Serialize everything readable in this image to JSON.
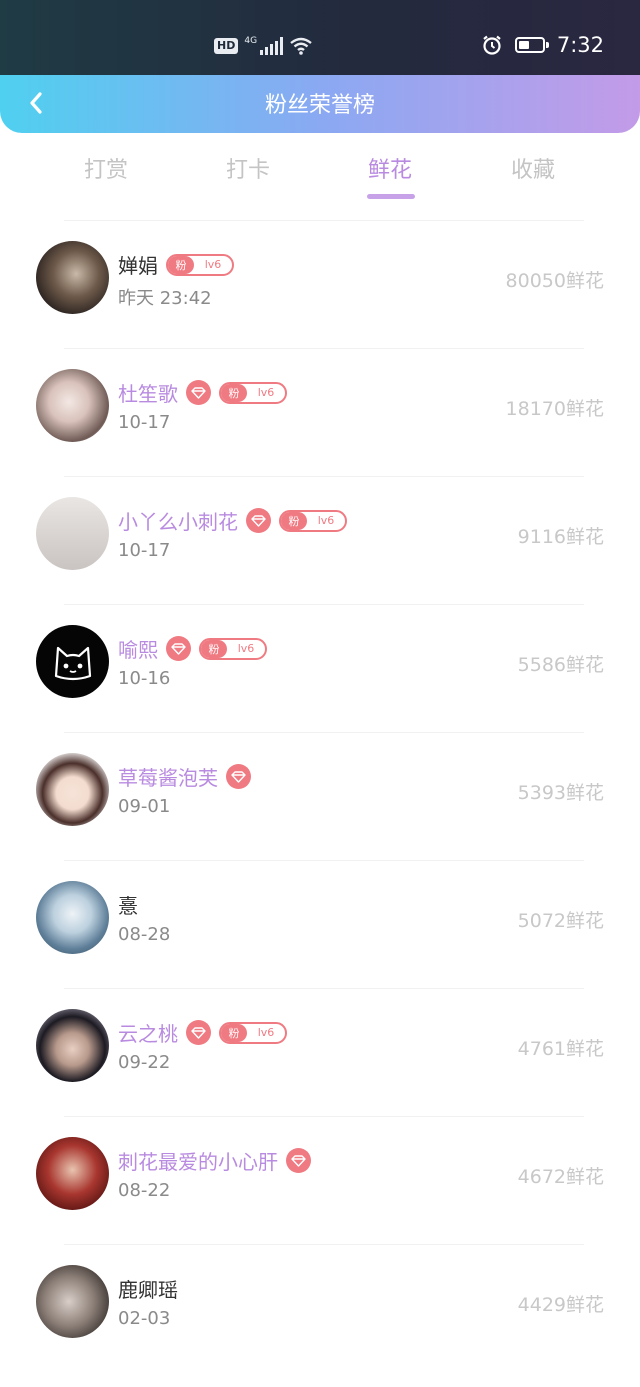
{
  "status_bar": {
    "hd": "HD",
    "network": "4G",
    "time": "7:32"
  },
  "header": {
    "title": "粉丝荣誉榜"
  },
  "tabs": [
    {
      "label": "打赏",
      "active": false
    },
    {
      "label": "打卡",
      "active": false
    },
    {
      "label": "鲜花",
      "active": true
    },
    {
      "label": "收藏",
      "active": false
    }
  ],
  "badges": {
    "fan": "粉",
    "level": "lv6"
  },
  "fans": [
    {
      "name": "婵娟",
      "date": "昨天 23:42",
      "score": "80050鲜花",
      "vip": false,
      "gem": false,
      "fan_badge": true
    },
    {
      "name": "杜笙歌",
      "date": "10-17",
      "score": "18170鲜花",
      "vip": true,
      "gem": true,
      "fan_badge": true
    },
    {
      "name": "小丫么小刺花",
      "date": "10-17",
      "score": "9116鲜花",
      "vip": true,
      "gem": true,
      "fan_badge": true
    },
    {
      "name": "喻熙",
      "date": "10-16",
      "score": "5586鲜花",
      "vip": true,
      "gem": true,
      "fan_badge": true
    },
    {
      "name": "草莓酱泡芙",
      "date": "09-01",
      "score": "5393鲜花",
      "vip": true,
      "gem": true,
      "fan_badge": false
    },
    {
      "name": "憙",
      "date": "08-28",
      "score": "5072鲜花",
      "vip": false,
      "gem": false,
      "fan_badge": false
    },
    {
      "name": "云之桃",
      "date": "09-22",
      "score": "4761鲜花",
      "vip": true,
      "gem": true,
      "fan_badge": true
    },
    {
      "name": "刺花最爱的小心肝",
      "date": "08-22",
      "score": "4672鲜花",
      "vip": true,
      "gem": true,
      "fan_badge": false
    },
    {
      "name": "鹿卿瑶",
      "date": "02-03",
      "score": "4429鲜花",
      "vip": false,
      "gem": false,
      "fan_badge": false
    }
  ],
  "colors": {
    "accent": "#b98be0",
    "badge": "#f07a82",
    "header_start": "#4fd0f0",
    "header_end": "#c39be8"
  }
}
